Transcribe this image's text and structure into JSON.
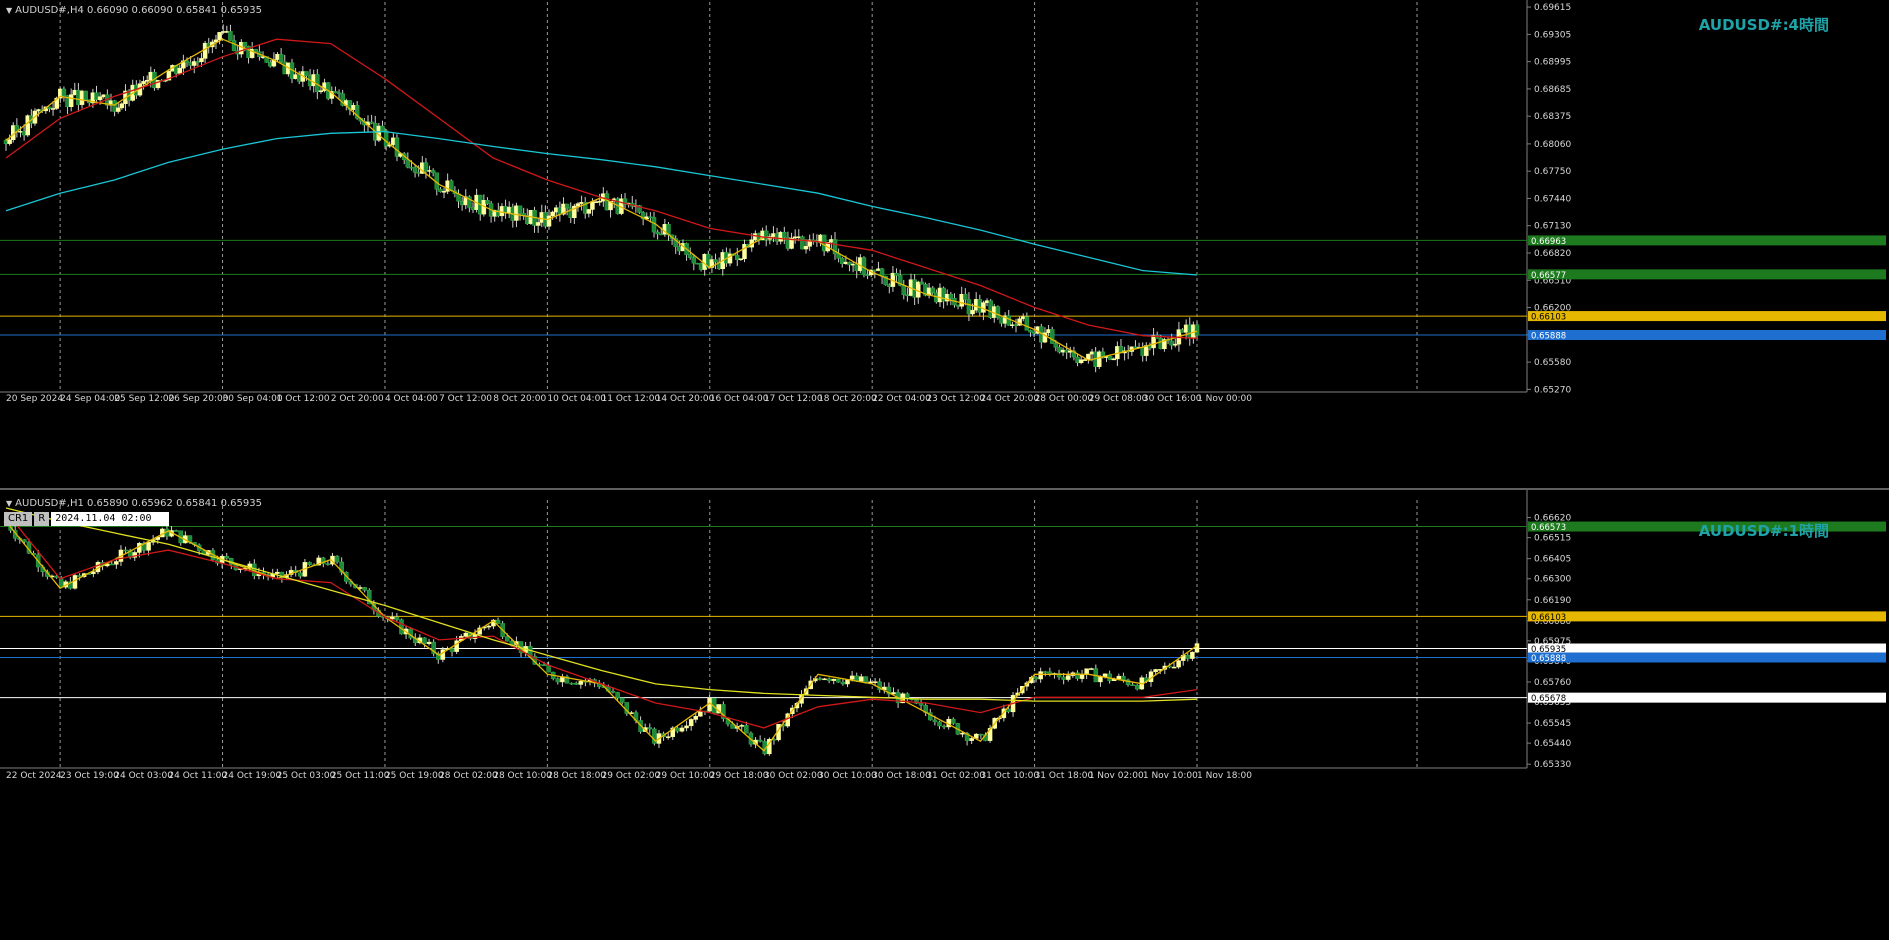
{
  "panes": [
    {
      "id": "h4",
      "header": "AUDUSD#,H4  0.66090 0.66090 0.65841 0.65935",
      "watermark": "AUDUSD#:4時間",
      "yticks": [
        "0.69615",
        "0.69305",
        "0.68995",
        "0.68685",
        "0.68375",
        "0.68060",
        "0.67750",
        "0.67440",
        "0.67130",
        "0.66820",
        "0.66510",
        "0.66200",
        "0.65890",
        "0.65580",
        "0.65270"
      ],
      "xticks": [
        "20 Sep 2024",
        "24 Sep 04:00",
        "25 Sep 12:00",
        "26 Sep 20:00",
        "30 Sep 04:00",
        "1 Oct 12:00",
        "2 Oct 20:00",
        "4 Oct 04:00",
        "7 Oct 12:00",
        "8 Oct 20:00",
        "10 Oct 04:00",
        "11 Oct 12:00",
        "14 Oct 20:00",
        "16 Oct 04:00",
        "17 Oct 12:00",
        "18 Oct 20:00",
        "22 Oct 04:00",
        "23 Oct 12:00",
        "24 Oct 20:00",
        "28 Oct 00:00",
        "29 Oct 08:00",
        "30 Oct 16:00",
        "1 Nov 00:00"
      ],
      "price_labels": [
        {
          "text": "0.66963",
          "color": "#1e7a1e"
        },
        {
          "text": "0.66577",
          "color": "#1e7a1e"
        },
        {
          "text": "0.66103",
          "color": "#e6b800"
        },
        {
          "text": "0.65888",
          "color": "#1e6fd0"
        }
      ]
    },
    {
      "id": "h1",
      "header": "AUDUSD#,H1  0.65890 0.65962 0.65841 0.65935",
      "watermark": "AUDUSD#:1時間",
      "cursor": {
        "cr": "CR1",
        "r": "R",
        "time": "2024.11.04 02:00"
      },
      "yticks": [
        "0.66620",
        "0.66515",
        "0.66405",
        "0.66300",
        "0.66190",
        "0.66080",
        "0.65975",
        "0.65870",
        "0.65760",
        "0.65655",
        "0.65545",
        "0.65440",
        "0.65330"
      ],
      "xticks": [
        "22 Oct 2024",
        "23 Oct 19:00",
        "24 Oct 03:00",
        "24 Oct 11:00",
        "24 Oct 19:00",
        "25 Oct 03:00",
        "25 Oct 11:00",
        "25 Oct 19:00",
        "28 Oct 02:00",
        "28 Oct 10:00",
        "28 Oct 18:00",
        "29 Oct 02:00",
        "29 Oct 10:00",
        "29 Oct 18:00",
        "30 Oct 02:00",
        "30 Oct 10:00",
        "30 Oct 18:00",
        "31 Oct 02:00",
        "31 Oct 10:00",
        "31 Oct 18:00",
        "1 Nov 02:00",
        "1 Nov 10:00",
        "1 Nov 18:00"
      ],
      "price_labels": [
        {
          "text": "0.66573",
          "color": "#1e7a1e"
        },
        {
          "text": "0.66103",
          "color": "#e6b800"
        },
        {
          "text": "0.65935",
          "color": "#ffffff"
        },
        {
          "text": "0.65888",
          "color": "#1e6fd0"
        },
        {
          "text": "0.65678",
          "color": "#ffffff"
        }
      ]
    }
  ],
  "chart_data": [
    {
      "type": "line",
      "title": "AUDUSD#:4時間",
      "ylim": [
        0.6524,
        0.6965
      ],
      "categories": [
        "20 Sep 2024",
        "24 Sep 04:00",
        "25 Sep 12:00",
        "26 Sep 20:00",
        "30 Sep 04:00",
        "1 Oct 12:00",
        "2 Oct 20:00",
        "4 Oct 04:00",
        "7 Oct 12:00",
        "8 Oct 20:00",
        "10 Oct 04:00",
        "11 Oct 12:00",
        "14 Oct 20:00",
        "16 Oct 04:00",
        "17 Oct 12:00",
        "18 Oct 20:00",
        "22 Oct 04:00",
        "23 Oct 12:00",
        "24 Oct 20:00",
        "28 Oct 00:00",
        "29 Oct 08:00",
        "30 Oct 16:00",
        "1 Nov 00:00"
      ],
      "series": [
        {
          "values": [
            0.681,
            0.686,
            0.685,
            0.689,
            0.6925,
            0.69,
            0.6865,
            0.681,
            0.676,
            0.673,
            0.672,
            0.6745,
            0.6715,
            0.6665,
            0.67,
            0.6695,
            0.666,
            0.6635,
            0.662,
            0.6595,
            0.656,
            0.6575,
            0.6593
          ]
        },
        {
          "values": [
            0.679,
            0.6835,
            0.686,
            0.688,
            0.6905,
            0.6925,
            0.692,
            0.688,
            0.6835,
            0.679,
            0.6765,
            0.6745,
            0.673,
            0.671,
            0.67,
            0.6695,
            0.6685,
            0.6665,
            0.6645,
            0.662,
            0.66,
            0.6588,
            0.6585
          ]
        },
        {
          "values": [
            0.673,
            0.675,
            0.6765,
            0.6785,
            0.68,
            0.6812,
            0.6818,
            0.682,
            0.6812,
            0.6803,
            0.6795,
            0.6788,
            0.678,
            0.677,
            0.676,
            0.675,
            0.6735,
            0.6722,
            0.6708,
            0.6692,
            0.6677,
            0.6662,
            0.6657
          ]
        }
      ],
      "hlines": [
        0.66963,
        0.66577,
        0.66103,
        0.65888
      ]
    },
    {
      "type": "line",
      "title": "AUDUSD#:1時間",
      "ylim": [
        0.6531,
        0.6667
      ],
      "categories": [
        "22 Oct 2024",
        "23 Oct 19:00",
        "24 Oct 03:00",
        "24 Oct 11:00",
        "24 Oct 19:00",
        "25 Oct 03:00",
        "25 Oct 11:00",
        "25 Oct 19:00",
        "28 Oct 02:00",
        "28 Oct 10:00",
        "28 Oct 18:00",
        "29 Oct 02:00",
        "29 Oct 10:00",
        "29 Oct 18:00",
        "30 Oct 02:00",
        "30 Oct 10:00",
        "30 Oct 18:00",
        "31 Oct 02:00",
        "31 Oct 10:00",
        "31 Oct 18:00",
        "1 Nov 02:00",
        "1 Nov 10:00",
        "1 Nov 18:00"
      ],
      "series": [
        {
          "values": [
            0.666,
            0.6625,
            0.664,
            0.6655,
            0.664,
            0.663,
            0.664,
            0.661,
            0.659,
            0.6608,
            0.658,
            0.6575,
            0.6545,
            0.6565,
            0.654,
            0.658,
            0.6575,
            0.656,
            0.6545,
            0.658,
            0.658,
            0.6575,
            0.6595
          ]
        },
        {
          "values": [
            0.6665,
            0.663,
            0.664,
            0.6645,
            0.6638,
            0.663,
            0.6628,
            0.661,
            0.6598,
            0.66,
            0.6585,
            0.6575,
            0.6565,
            0.656,
            0.6552,
            0.6563,
            0.6567,
            0.6565,
            0.656,
            0.6568,
            0.6568,
            0.6568,
            0.6572
          ]
        },
        {
          "values": [
            0.6667,
            0.666,
            0.6654,
            0.6648,
            0.664,
            0.6632,
            0.6624,
            0.6616,
            0.6607,
            0.6598,
            0.659,
            0.6582,
            0.6575,
            0.6572,
            0.657,
            0.6569,
            0.6568,
            0.6567,
            0.6567,
            0.6566,
            0.6566,
            0.6566,
            0.6567
          ]
        }
      ],
      "hlines": [
        0.66573,
        0.66103,
        0.65888,
        0.65678
      ]
    }
  ]
}
